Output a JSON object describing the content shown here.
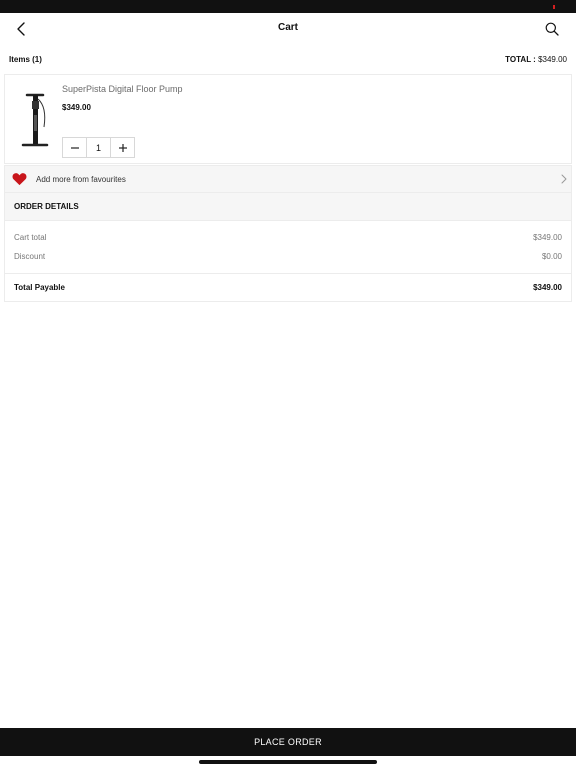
{
  "nav": {
    "title": "Cart",
    "back_icon": "chevron-left-icon",
    "search_icon": "search-icon"
  },
  "summary": {
    "items_label": "Items (1)",
    "total_label": "TOTAL :",
    "total_value": "$349.00"
  },
  "cart_items": [
    {
      "name": "SuperPista Digital Floor Pump",
      "price": "$349.00",
      "quantity": "1",
      "image_icon": "floor-pump-image"
    }
  ],
  "favourites": {
    "label": "Add more from favourites",
    "icon": "heart-icon",
    "heart_color": "#c8151b"
  },
  "order_details": {
    "header": "ORDER DETAILS",
    "rows": [
      {
        "label": "Cart total",
        "value": "$349.00"
      },
      {
        "label": "Discount",
        "value": "$0.00"
      }
    ],
    "total": {
      "label": "Total Payable",
      "value": "$349.00"
    }
  },
  "footer": {
    "place_order_label": "PLACE ORDER"
  },
  "colors": {
    "primary": "#111111",
    "panel_bg": "#f6f6f6"
  }
}
